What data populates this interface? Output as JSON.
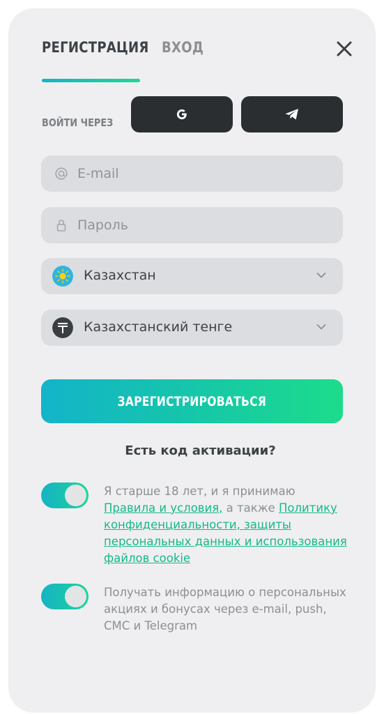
{
  "tabs": {
    "register": "РЕГИСТРАЦИЯ",
    "login": "ВХОД"
  },
  "social": {
    "label": "ВОЙТИ ЧЕРЕЗ",
    "google_letter": "G"
  },
  "form": {
    "email_placeholder": "E-mail",
    "password_placeholder": "Пароль",
    "country_value": "Казахстан",
    "currency_value": "Казахстанский тенге"
  },
  "submit_label": "ЗАРЕГИСТРИРОВАТЬСЯ",
  "activation_link": "Есть код активации?",
  "consent_terms": {
    "text1": "Я старше 18 лет, и я принимаю",
    "link1": "Правила и условия,",
    "text2": " а также ",
    "link2": "Политику конфиденциальности, защиты персональных данных и использования файлов cookie",
    "checked": true
  },
  "consent_promo": {
    "text": "Получать информацию о персональных акциях и бонусах через e-mail, push, СМС и Telegram",
    "checked": true
  },
  "colors": {
    "accent_start": "#13b4c9",
    "accent_end": "#1cdc8b",
    "link": "#16b88a",
    "dark_button": "#2b2e31",
    "card_bg": "#efeff1",
    "field_bg": "#dcdde0"
  },
  "icons": [
    "close-icon",
    "google-icon",
    "telegram-icon",
    "at-icon",
    "lock-icon",
    "kazakhstan-flag-icon",
    "tenge-icon",
    "chevron-down-icon"
  ]
}
